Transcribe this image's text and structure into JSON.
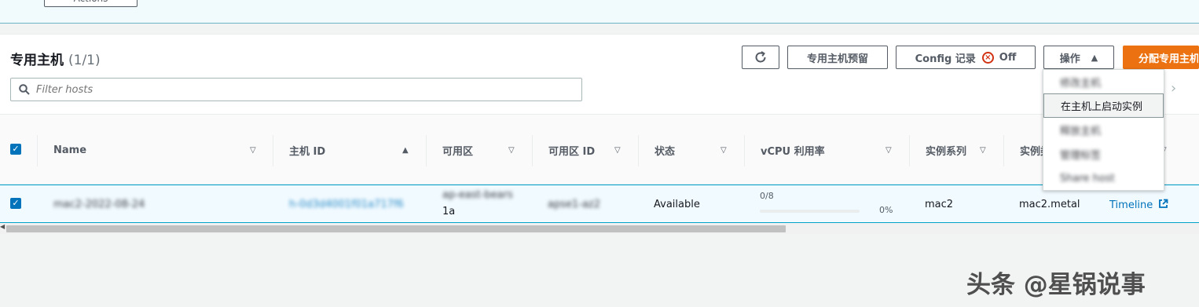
{
  "top_button": {
    "label": "Actions"
  },
  "header": {
    "title": "专用主机",
    "count": "(1/1)",
    "refresh_icon": "refresh-icon",
    "reserve_label": "专用主机预留",
    "config_label": "Config 记录",
    "config_status": "Off",
    "actions_label": "操作",
    "allocate_label": "分配专用主机"
  },
  "search": {
    "placeholder": "Filter hosts"
  },
  "table": {
    "columns": [
      {
        "label": "Name"
      },
      {
        "label": "主机 ID"
      },
      {
        "label": "可用区"
      },
      {
        "label": "可用区 ID"
      },
      {
        "label": "状态"
      },
      {
        "label": "vCPU 利用率"
      },
      {
        "label": "实例系列"
      },
      {
        "label": "实例类型"
      }
    ],
    "row": {
      "name": "mac2-2022-08-24",
      "host_id": "h-0d3d4001f01a717f6",
      "az": "ap-east-bears",
      "az_line2": "1a",
      "az_id": "apse1-az2",
      "state": "Available",
      "vcpu_fraction": "0/8",
      "vcpu_percent": "0%",
      "vcpu_progress": 0,
      "family": "mac2",
      "type": "mac2.metal",
      "timeline": "Timeline"
    }
  },
  "dropdown": {
    "items": [
      {
        "label": "修改主机"
      },
      {
        "label": "在主机上启动实例"
      },
      {
        "label": "释放主机"
      },
      {
        "label": "管理标签"
      },
      {
        "label": "Share host"
      }
    ]
  },
  "watermark": "头条 @星锅说事",
  "colors": {
    "primary": "#ec7211",
    "link": "#0073bb",
    "selected_row": "#f1faff",
    "error": "#d13212"
  }
}
